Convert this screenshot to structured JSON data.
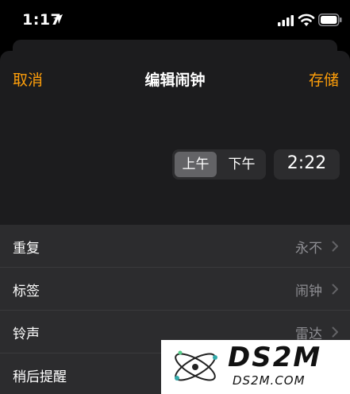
{
  "status_bar": {
    "time": "1:17",
    "icons": [
      "location-arrow-icon",
      "cellular-signal-icon",
      "wifi-icon",
      "battery-icon"
    ]
  },
  "nav": {
    "cancel_label": "取消",
    "title": "编辑闹钟",
    "save_label": "存储"
  },
  "picker": {
    "am_label": "上午",
    "pm_label": "下午",
    "selected_period": "上午",
    "time": "2:22"
  },
  "rows": [
    {
      "label": "重复",
      "value": "永不"
    },
    {
      "label": "标签",
      "value": "闹钟"
    },
    {
      "label": "铃声",
      "value": "雷达"
    },
    {
      "label": "稍后提醒",
      "value": ""
    }
  ],
  "watermark": {
    "big_text": "DS2M",
    "small_text": "DS2M.COM"
  },
  "colors": {
    "accent": "#ff9f0a",
    "sheet_bg": "#1c1c1e",
    "row_bg": "#2c2c2e",
    "secondary_text": "#8e8e93"
  }
}
